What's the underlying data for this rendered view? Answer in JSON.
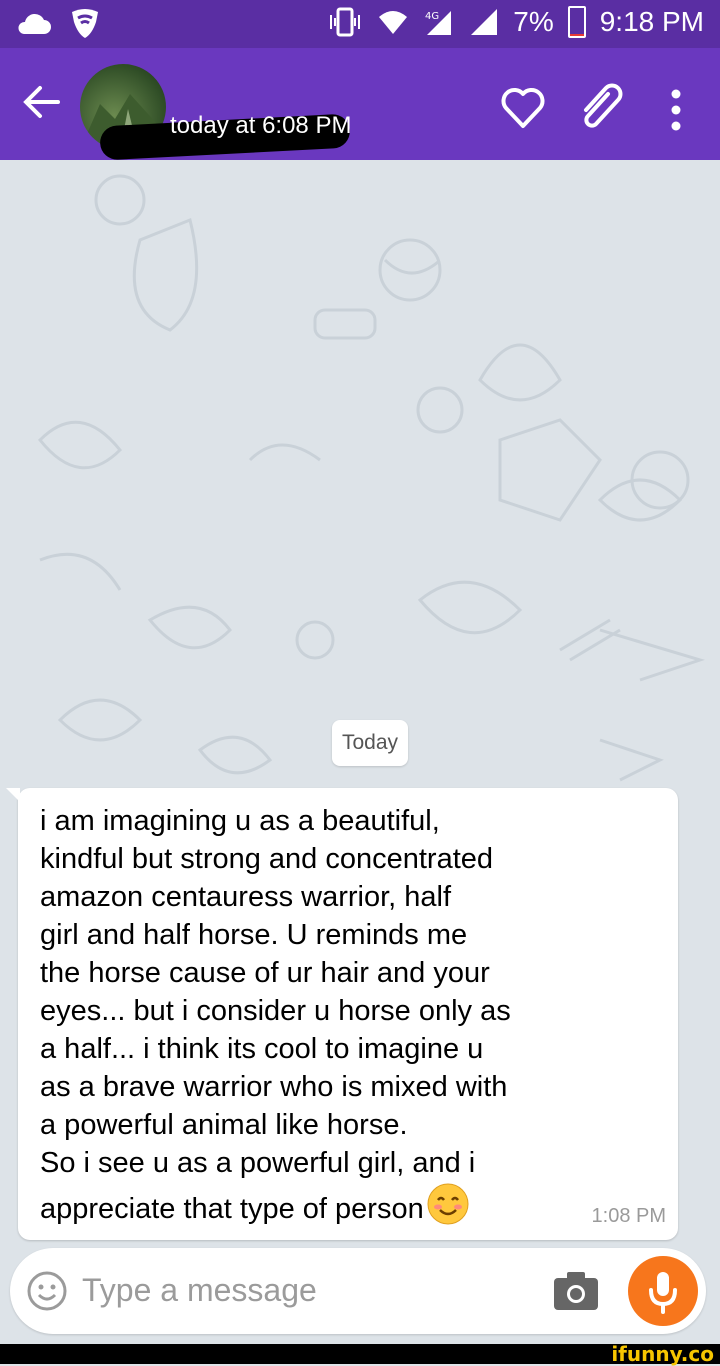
{
  "status_bar": {
    "battery": "7%",
    "battery_level": 0.07,
    "time": "9:18 PM",
    "icons": [
      "cloud-icon",
      "wifi-shield-icon",
      "vibrate-icon",
      "wifi-icon",
      "signal-4g-icon",
      "signal-icon"
    ]
  },
  "header": {
    "subtitle": "today at 6:08 PM",
    "icons": [
      "back-arrow-icon",
      "heart-icon",
      "paperclip-icon",
      "more-vert-icon"
    ]
  },
  "chat": {
    "date_separator": "Today",
    "message": {
      "text": "i am imagining u as a beautiful,\nkindful but strong and concentrated\namazon centauress warrior, half\ngirl and half horse. U reminds me\nthe horse cause of ur hair and your\neyes... but i consider u horse only as\na half... i think its cool to imagine u\nas a brave warrior who is mixed with\na powerful animal like horse.\nSo i see u as a powerful girl, and i\nappreciate that type of person",
      "time": "1:08 PM",
      "emoji": "smiling-face-icon"
    }
  },
  "input": {
    "placeholder": "Type a message",
    "icons": [
      "emoji-icon",
      "camera-icon",
      "microphone-icon"
    ]
  },
  "colors": {
    "statusbar": "#5a2ea3",
    "appbar": "#6a38bf",
    "mic_button": "#f7761c",
    "chat_background": "#dde3e8"
  },
  "watermark": "ifunny.co"
}
